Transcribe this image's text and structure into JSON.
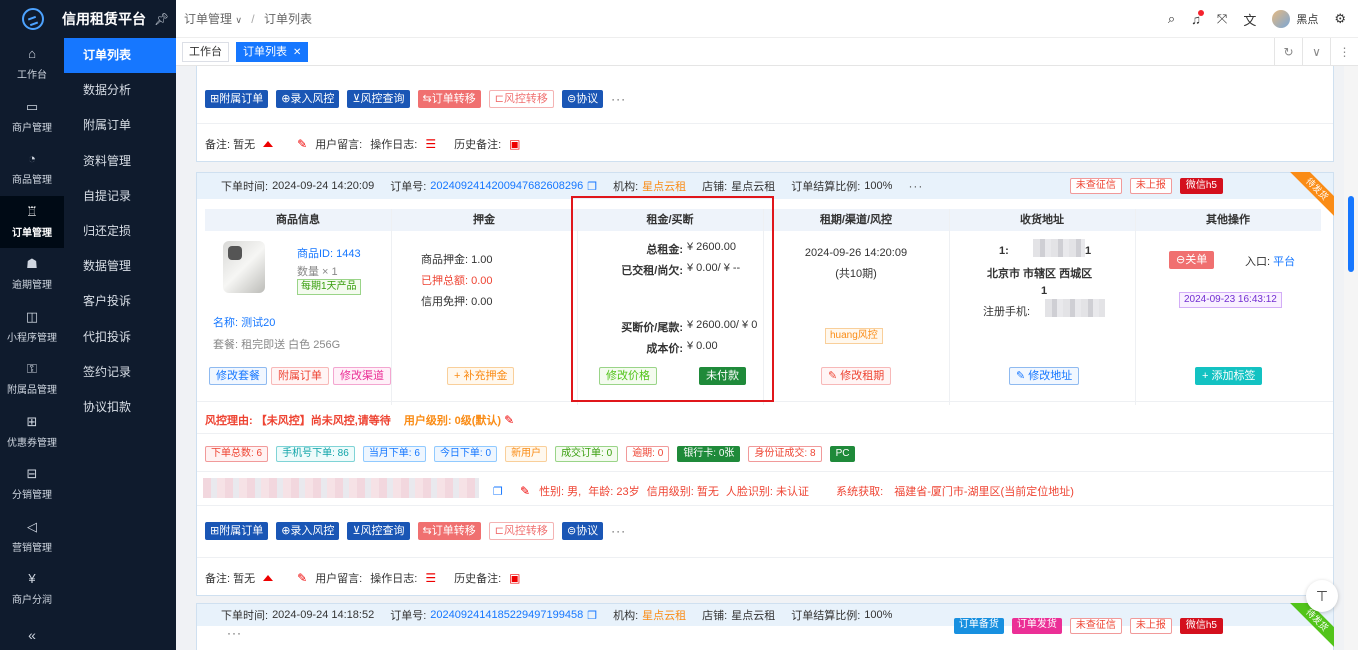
{
  "app": {
    "title": "信用租赁平台"
  },
  "rail": [
    {
      "label": "工作台",
      "icon": "⌂"
    },
    {
      "label": "商户管理",
      "icon": "▭"
    },
    {
      "label": "商品管理",
      "icon": "◔"
    },
    {
      "label": "订单管理",
      "icon": "♖",
      "active": true
    },
    {
      "label": "逾期管理",
      "icon": "☗"
    },
    {
      "label": "小程序管理",
      "icon": "◫"
    },
    {
      "label": "附属品管理",
      "icon": "⚿"
    },
    {
      "label": "优惠券管理",
      "icon": "⊞"
    },
    {
      "label": "分销管理",
      "icon": "⊟"
    },
    {
      "label": "营销管理",
      "icon": "◁"
    },
    {
      "label": "商户分润",
      "icon": "¥"
    }
  ],
  "submenu": [
    "订单列表",
    "数据分析",
    "附属订单",
    "资料管理",
    "自提记录",
    "归还定损",
    "数据管理",
    "客户投诉",
    "代扣投诉",
    "签约记录",
    "协议扣款"
  ],
  "breadcrumb": {
    "parent": "订单管理",
    "current": "订单列表"
  },
  "header": {
    "user": "黑点"
  },
  "tabs": {
    "home": "工作台",
    "current": "订单列表"
  },
  "actions": {
    "attached": "⊞附属订单",
    "entry_risk": "⊕录入风控",
    "risk_query": "⊻风控查询",
    "transfer": "⇆订单转移",
    "risk_transfer": "⊏风控转移",
    "protocol": "⊜协议",
    "more": "···"
  },
  "notes": {
    "remark": "备注: 暂无",
    "user_msg": "用户留言:",
    "op_log": "操作日志:",
    "history": "历史备注:"
  },
  "order1": {
    "time_label": "下单时间:",
    "time": "2024-09-24 14:20:09",
    "no_label": "订单号:",
    "no": "20240924142009476826082​96",
    "org_label": "机构:",
    "org": "星点云租",
    "shop_label": "店铺:",
    "shop": "星点云租",
    "ratio_label": "订单结算比例:",
    "ratio": "100%",
    "chips": [
      "未查征信",
      "未上报",
      "微信h5"
    ],
    "ribbon": "待发货",
    "columns": [
      "商品信息",
      "押金",
      "租金/买断",
      "租期/渠道/风控",
      "收货地址",
      "其他操作"
    ],
    "product": {
      "id_label": "商品ID:",
      "id": "1443",
      "qty": "数量 × 1",
      "tag": "每期1天产品",
      "name_label": "名称:",
      "name": "测试20",
      "pkg": "套餐: 租完即送 白色 256G"
    },
    "deposit": {
      "goods": "商品押金: 1.00",
      "paid_label": "已押总额:",
      "paid": "0.00",
      "credit": "信用免押: 0.00"
    },
    "rent": {
      "total_label": "总租金:",
      "total": "¥ 2600.00",
      "paid_label": "已交租/尚欠:",
      "paid": "¥ 0.00/ ¥ --",
      "buyout_label": "买断价/尾款:",
      "buyout": "¥ 2600.00/ ¥ 0",
      "cost_label": "成本价:",
      "cost": "¥ 0.00"
    },
    "term": {
      "start": "2024-09-26 14:20:09",
      "periods": "(共10期)",
      "risk_tag": "huang风控"
    },
    "address": {
      "line1a": "1:",
      "line1b": "1",
      "city": "北京市 市辖区 西城区",
      "line3": "1",
      "phone_label": "注册手机:"
    },
    "other": {
      "close": "⊖关单",
      "entry_label": "入口:",
      "entry": "平台",
      "date": "2024-09-23 16:43:12"
    },
    "btns": {
      "modify_pkg": "修改套餐",
      "attached": "附属订单",
      "modify_channel": "修改渠道",
      "add_deposit": "+ 补充押金",
      "modify_price": "修改价格",
      "unpaid": "未付款",
      "modify_term": "✎ 修改租期",
      "modify_addr": "✎ 修改地址",
      "add_tag": "+ 添加标签"
    },
    "risk": {
      "reason_label": "风控理由:",
      "reason": "【未风控】尚未风控,请等待",
      "level_label": "用户级别:",
      "level": "0级(默认)"
    },
    "tags": [
      "下单总数: 6",
      "手机号下单: 86",
      "当月下单: 6",
      "今日下单: 0",
      "新用户",
      "成交订单: 0",
      "逾期: 0",
      "银行卡: 0张",
      "身份证成交: 8",
      "PC"
    ],
    "info": {
      "sex": "性别: 男,",
      "age": "年龄: 23岁",
      "credit": "信用级别: 暂无",
      "face": "人脸识别: 未认证",
      "system": "系统获取:",
      "location": "福建省-厦门市-湖里区(当前定位地址)"
    }
  },
  "order2": {
    "time_label": "下单时间:",
    "time": "2024-09-24 14:18:52",
    "no_label": "订单号:",
    "no": "20240924141852294971994​58",
    "org_label": "机构:",
    "org": "星点云租",
    "shop_label": "店铺:",
    "shop": "星点云租",
    "ratio_label": "订单结算比例:",
    "ratio": "100%",
    "chips": [
      "订单备货",
      "订单发货",
      "未查征信",
      "未上报",
      "微信h5"
    ],
    "ribbon": "待发货",
    "more": "···"
  }
}
